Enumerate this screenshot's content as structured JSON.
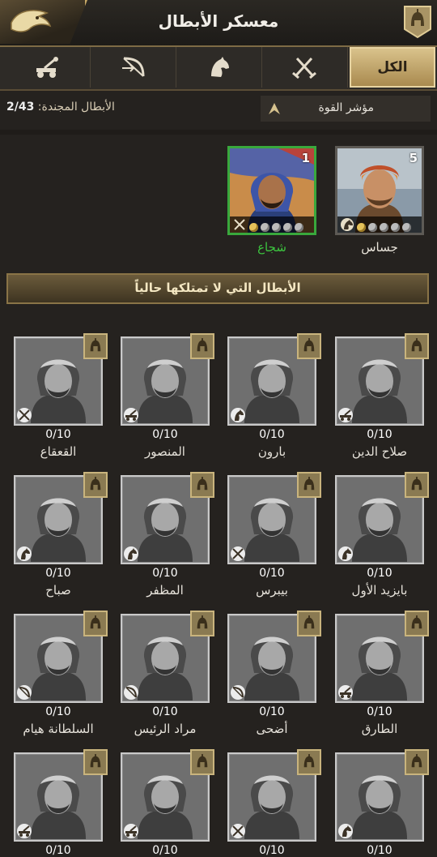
{
  "header": {
    "title": "معسكر الأبطال",
    "back_icon": "eagle-head-icon",
    "badge_icon": "helmet-icon"
  },
  "tabs": [
    {
      "label": "الكل",
      "icon": "",
      "active": true
    },
    {
      "label": "",
      "icon": "crossed-swords-icon",
      "active": false
    },
    {
      "label": "",
      "icon": "horse-head-icon",
      "active": false
    },
    {
      "label": "",
      "icon": "bow-icon",
      "active": false
    },
    {
      "label": "",
      "icon": "catapult-icon",
      "active": false
    }
  ],
  "filter": {
    "power_label": "مؤشر القوة",
    "recruited_label": "الأبطال المجندة:",
    "recruited_count": "2/43"
  },
  "owned": [
    {
      "name": "جساس",
      "level": "5",
      "gold_stars": 1,
      "total_stars": 5,
      "cls": "cavalry",
      "selected": false
    },
    {
      "name": "شجاع",
      "level": "1",
      "gold_stars": 1,
      "total_stars": 5,
      "cls": "infantry",
      "selected": true
    }
  ],
  "banner": "الأبطال التي لا تمتلكها حالياً",
  "locked": [
    {
      "name": "صلاح الدين",
      "progress": "0/10",
      "cls": "siege"
    },
    {
      "name": "بارون",
      "progress": "0/10",
      "cls": "cavalry"
    },
    {
      "name": "المنصور",
      "progress": "0/10",
      "cls": "siege"
    },
    {
      "name": "القعقاع",
      "progress": "0/10",
      "cls": "infantry"
    },
    {
      "name": "بايزيد الأول",
      "progress": "0/10",
      "cls": "cavalry"
    },
    {
      "name": "بيبرس",
      "progress": "0/10",
      "cls": "infantry"
    },
    {
      "name": "المظفر",
      "progress": "0/10",
      "cls": "cavalry"
    },
    {
      "name": "صباح",
      "progress": "0/10",
      "cls": "cavalry"
    },
    {
      "name": "الطارق",
      "progress": "0/10",
      "cls": "siege"
    },
    {
      "name": "أضحى",
      "progress": "0/10",
      "cls": "archer"
    },
    {
      "name": "مراد الرئيس",
      "progress": "0/10",
      "cls": "archer"
    },
    {
      "name": "السلطانة هيام",
      "progress": "0/10",
      "cls": "archer"
    },
    {
      "name": "",
      "progress": "0/10",
      "cls": "cavalry"
    },
    {
      "name": "",
      "progress": "0/10",
      "cls": "infantry"
    },
    {
      "name": "",
      "progress": "0/10",
      "cls": "siege"
    },
    {
      "name": "",
      "progress": "0/10",
      "cls": "siege"
    }
  ]
}
